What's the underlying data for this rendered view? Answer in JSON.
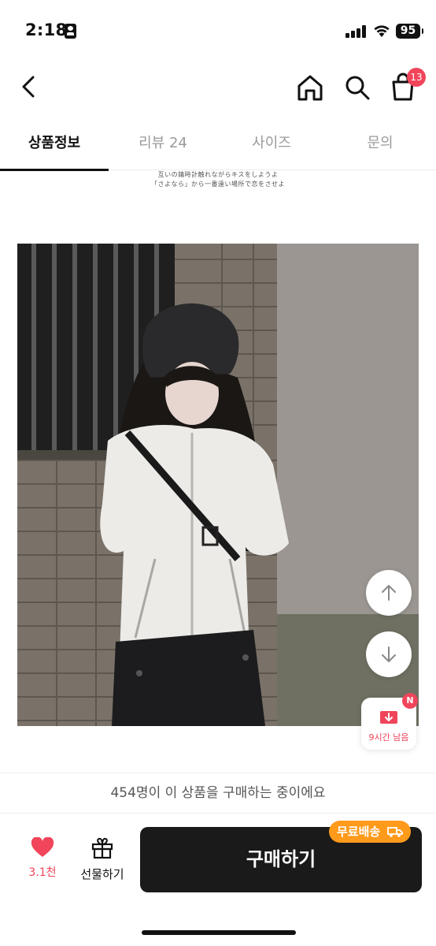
{
  "status_bar": {
    "time": "2:18",
    "battery": "95"
  },
  "nav": {
    "cart_count": "13"
  },
  "tabs": [
    {
      "label": "상품정보",
      "active": true
    },
    {
      "label": "리뷰 24",
      "active": false
    },
    {
      "label": "사이즈",
      "active": false
    },
    {
      "label": "문의",
      "active": false
    }
  ],
  "content": {
    "caption_lines": [
      "互いの錆時計触れながらキスをしようよ",
      "「さよなら」から一番遠い場所で恋をさせよ"
    ]
  },
  "floating": {
    "timer_label": "9시간 남음",
    "timer_badge": "N"
  },
  "notice": "454명이 이 상품을 구매하는 중이에요",
  "bottom_bar": {
    "like_count": "3.1천",
    "gift_label": "선물하기",
    "buy_label": "구매하기",
    "free_shipping_label": "무료배송"
  },
  "colors": {
    "accent": "#f0455a",
    "buy_button": "#1a1a1a",
    "free_shipping": "#ff9a1a"
  }
}
